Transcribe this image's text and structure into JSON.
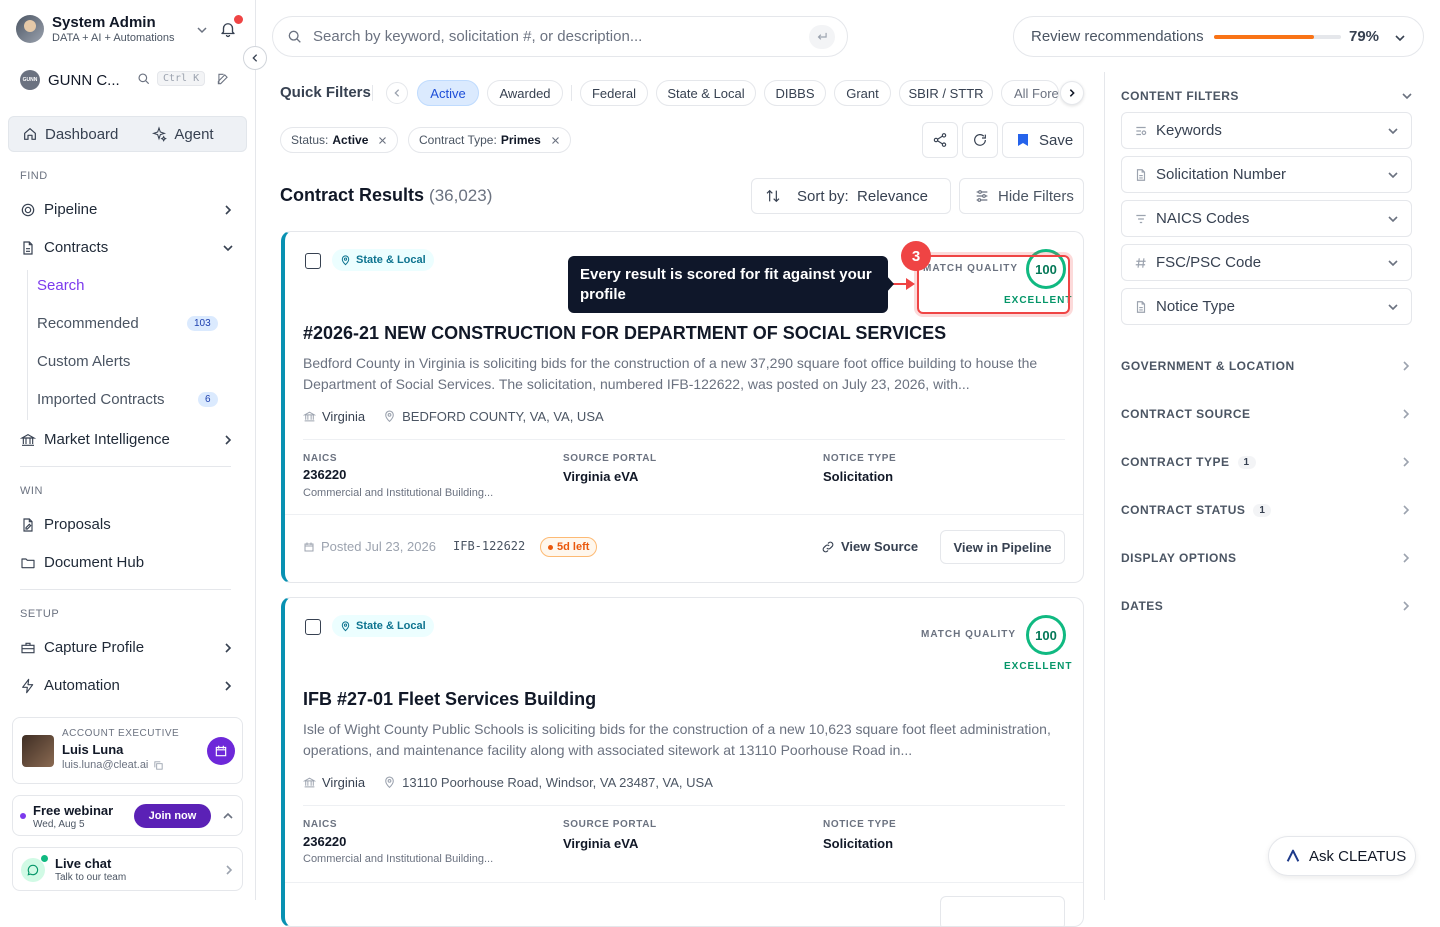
{
  "user": {
    "name": "System Admin",
    "subtitle": "DATA + AI + Automations"
  },
  "workspace": {
    "logo_text": "GUNN",
    "name": "GUNN C...",
    "shortcut": "Ctrl K"
  },
  "top_nav": {
    "dashboard": "Dashboard",
    "agent": "Agent"
  },
  "sections": {
    "find": "FIND",
    "win": "WIN",
    "setup": "SETUP"
  },
  "nav": {
    "pipeline": "Pipeline",
    "contracts": "Contracts",
    "contracts_sub": [
      {
        "label": "Search",
        "badge": ""
      },
      {
        "label": "Recommended",
        "badge": "103"
      },
      {
        "label": "Custom Alerts",
        "badge": ""
      },
      {
        "label": "Imported Contracts",
        "badge": "6"
      }
    ],
    "market_intelligence": "Market Intelligence",
    "proposals": "Proposals",
    "document_hub": "Document Hub",
    "capture_profile": "Capture Profile",
    "automation": "Automation"
  },
  "account_exec": {
    "label": "ACCOUNT EXECUTIVE",
    "name": "Luis Luna",
    "email": "luis.luna@cleat.ai"
  },
  "webinar": {
    "title": "Free webinar",
    "date": "Wed, Aug 5",
    "button": "Join now"
  },
  "live_chat": {
    "title": "Live chat",
    "subtitle": "Talk to our team"
  },
  "search": {
    "placeholder": "Search by keyword, solicitation #, or description..."
  },
  "review": {
    "label": "Review recommendations",
    "percent_text": "79%",
    "progress": 0.79
  },
  "quick_filters": {
    "label": "Quick Filters",
    "items": [
      "Active",
      "Awarded",
      "Federal",
      "State & Local",
      "DIBBS",
      "Grant",
      "SBIR / STTR",
      "All Forecasts"
    ],
    "active": "Active"
  },
  "applied_filters": [
    {
      "key": "Status:",
      "value": "Active"
    },
    {
      "key": "Contract Type:",
      "value": "Primes"
    }
  ],
  "toolbar": {
    "save": "Save",
    "sort_label": "Sort by:",
    "sort_value": "Relevance",
    "hide_filters": "Hide Filters"
  },
  "results": {
    "title": "Contract Results",
    "count": "(36,023)"
  },
  "tooltip": {
    "step": "3",
    "text": "Every result is scored for fit against your profile"
  },
  "cards": [
    {
      "tag": "State & Local",
      "match_label": "MATCH QUALITY",
      "score": "100",
      "grade": "EXCELLENT",
      "title": "#2026-21 NEW CONSTRUCTION FOR DEPARTMENT OF SOCIAL SERVICES",
      "description": "Bedford County in Virginia is soliciting bids for the construction of a new 37,290 square foot office building to house the Department of Social Services. The solicitation, numbered IFB-122622, was posted on July 23, 2026, with...",
      "agency": "Virginia",
      "location": "BEDFORD COUNTY, VA, VA, USA",
      "naics_label": "NAICS",
      "naics": "236220",
      "naics_desc": "Commercial and Institutional Building...",
      "portal_label": "SOURCE PORTAL",
      "portal": "Virginia eVA",
      "notice_label": "NOTICE TYPE",
      "notice": "Solicitation",
      "posted": "Posted Jul 23, 2026",
      "sol_number": "IFB-122622",
      "days_left": "5d left",
      "view_source": "View Source",
      "view_pipeline": "View in Pipeline"
    },
    {
      "tag": "State & Local",
      "match_label": "MATCH QUALITY",
      "score": "100",
      "grade": "EXCELLENT",
      "title": "IFB #27-01 Fleet Services Building",
      "description": "Isle of Wight County Public Schools is soliciting bids for the construction of a new 10,623 square foot fleet administration, operations, and maintenance facility along with associated sitework at 13110 Poorhouse Road in...",
      "agency": "Virginia",
      "location": "13110 Poorhouse Road, Windsor, VA 23487, VA, USA",
      "naics_label": "NAICS",
      "naics": "236220",
      "naics_desc": "Commercial and Institutional Building...",
      "portal_label": "SOURCE PORTAL",
      "portal": "Virginia eVA",
      "notice_label": "NOTICE TYPE",
      "notice": "Solicitation"
    }
  ],
  "right_panel": {
    "content_filters": "CONTENT FILTERS",
    "filters": [
      "Keywords",
      "Solicitation Number",
      "NAICS Codes",
      "FSC/PSC Code",
      "Notice Type"
    ],
    "groups": [
      {
        "label": "GOVERNMENT & LOCATION",
        "badge": ""
      },
      {
        "label": "CONTRACT SOURCE",
        "badge": ""
      },
      {
        "label": "CONTRACT TYPE",
        "badge": "1"
      },
      {
        "label": "CONTRACT STATUS",
        "badge": "1"
      },
      {
        "label": "DISPLAY OPTIONS",
        "badge": ""
      },
      {
        "label": "DATES",
        "badge": ""
      }
    ]
  },
  "ask": {
    "label": "Ask CLEATUS"
  }
}
